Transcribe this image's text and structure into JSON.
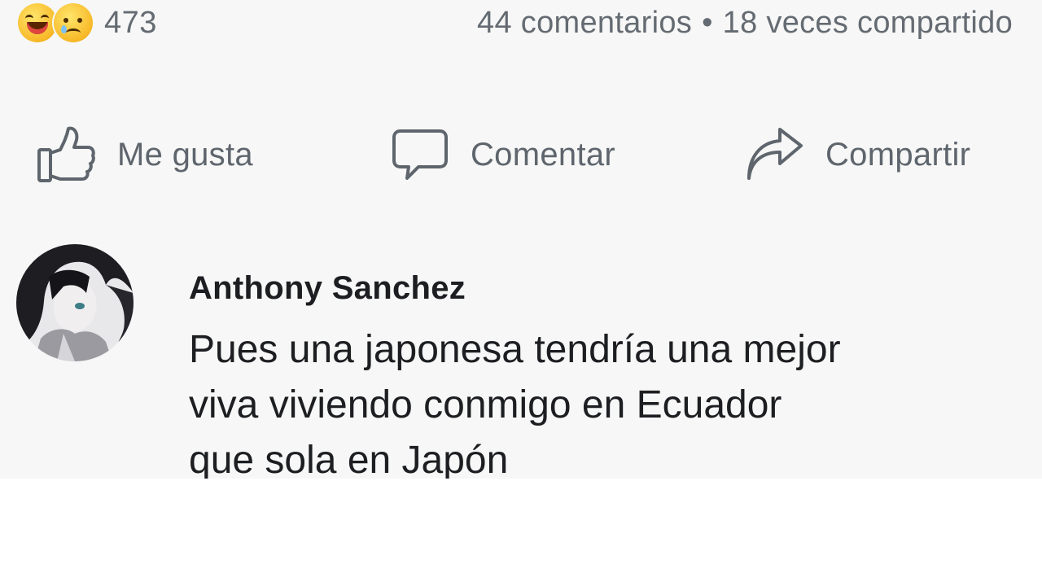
{
  "reactions": {
    "icons": [
      "haha-emoji-icon",
      "sad-emoji-icon"
    ],
    "count": "473"
  },
  "stats": {
    "comments": "44 comentarios",
    "separator": "•",
    "shares": "18 veces compartido"
  },
  "actions": [
    {
      "label": "Me gusta",
      "icon": "thumbs-up-icon"
    },
    {
      "label": "Comentar",
      "icon": "speech-bubble-icon"
    },
    {
      "label": "Compartir",
      "icon": "share-arrow-icon"
    }
  ],
  "comment": {
    "author": "Anthony Sanchez",
    "text_lines": [
      "Pues una japonesa tendría una mejor",
      "viva viviendo conmigo en Ecuador",
      "que sola en Japón"
    ]
  },
  "colors": {
    "post_background": "#f6f7f6",
    "page_background": "#ffffff",
    "secondary_text": "#656b72",
    "primary_text": "#1c1e21"
  }
}
